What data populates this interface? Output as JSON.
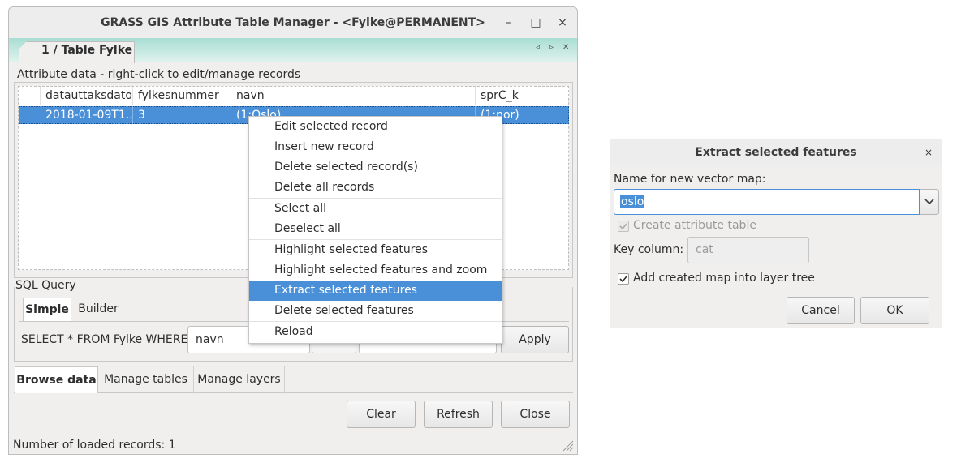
{
  "main_window": {
    "title": "GRASS GIS Attribute Table Manager - <Fylke@PERMANENT>",
    "minimize_glyph": "–",
    "maximize_glyph": "□",
    "close_glyph": "×",
    "notebook_tab": "1 / Table Fylke",
    "nav_left_glyph": "◃",
    "nav_right_glyph": "▹",
    "nav_close_glyph": "✕",
    "attribute_group_title": "Attribute data - right-click to edit/manage records",
    "columns": [
      "datauttaksdato",
      "fylkesnummer",
      "navn",
      "sprC_k"
    ],
    "rows": [
      [
        "2018-01-09T1...",
        "3",
        "(1:Oslo)",
        "(1:nor)"
      ]
    ],
    "sql": {
      "group_title": "SQL Query",
      "tabs": [
        "Simple",
        "Builder"
      ],
      "prefix": "SELECT * FROM Fylke WHERE",
      "column_value": "navn",
      "apply_label": "Apply"
    },
    "bottom_tabs": [
      "Browse data",
      "Manage tables",
      "Manage layers"
    ],
    "buttons": {
      "clear": "Clear",
      "refresh": "Refresh",
      "close": "Close"
    },
    "status": "Number of loaded records: 1"
  },
  "context_menu": {
    "groups": [
      [
        "Edit selected record",
        "Insert new record",
        "Delete selected record(s)",
        "Delete all records"
      ],
      [
        "Select all",
        "Deselect all"
      ],
      [
        "Highlight selected features",
        "Highlight selected features and zoom",
        "Extract selected features",
        "Delete selected features"
      ],
      [
        "Reload"
      ]
    ],
    "active_item": "Extract selected features"
  },
  "dialog": {
    "title": "Extract selected features",
    "close_glyph": "×",
    "name_label": "Name for new vector map:",
    "map_name": "oslo",
    "create_table_label": "Create attribute table",
    "create_table_checked": true,
    "create_table_enabled": false,
    "key_column_label": "Key column:",
    "key_column_placeholder": "cat",
    "add_to_tree_label": "Add created map into layer tree",
    "add_to_tree_checked": true,
    "cancel_label": "Cancel",
    "ok_label": "OK"
  },
  "colors": {
    "selection": "#4a90d9",
    "notebook_header": "#a8ded3",
    "window_bg": "#f0efee"
  }
}
